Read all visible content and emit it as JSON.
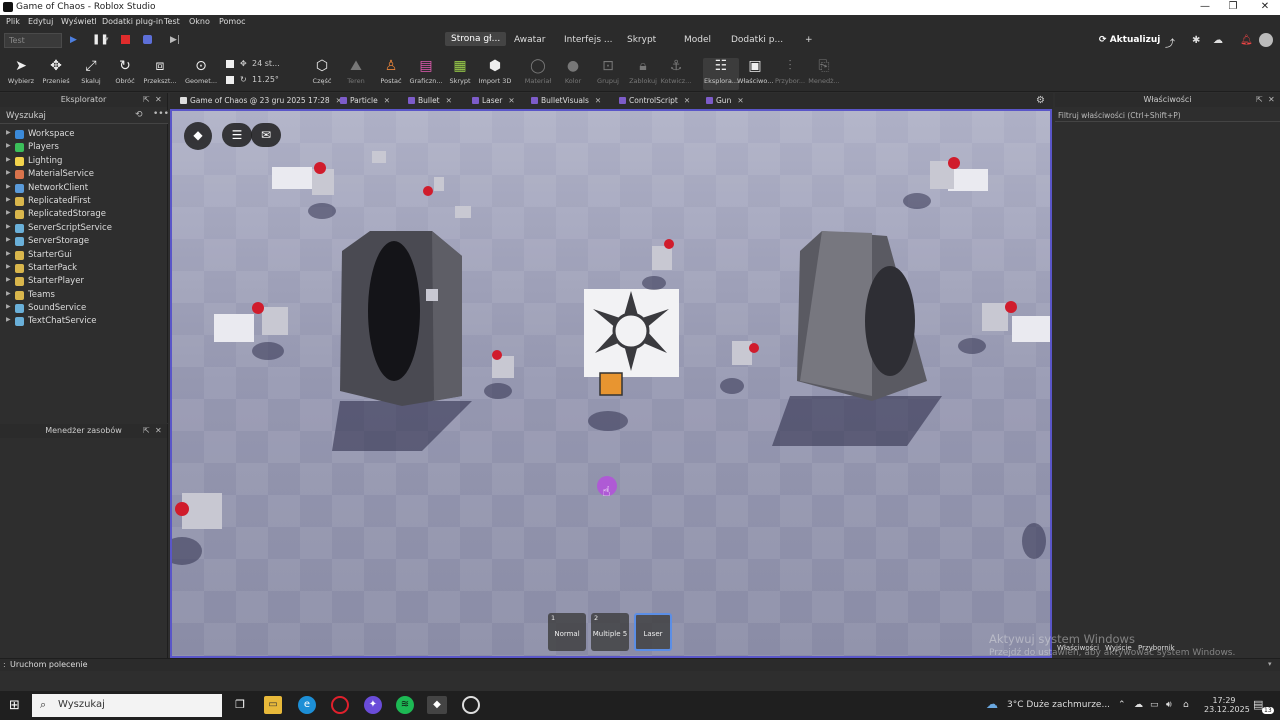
{
  "window": {
    "title": "Game of Chaos - Roblox Studio",
    "minimize": "—",
    "maximize": "❐",
    "close": "✕"
  },
  "menu": [
    "Plik",
    "Edytuj",
    "Wyświetl",
    "Dodatki plug-in",
    "Test",
    "Okno",
    "Pomoc"
  ],
  "ribbon": {
    "test_select": "Test",
    "tabs": [
      "Strona gł...",
      "Awatar",
      "Interfejs ...",
      "Skrypt",
      "Model",
      "Dodatki p..."
    ],
    "active_tab": "Strona gł...",
    "add_tab": "+",
    "update_label": "Aktualizuj"
  },
  "toolbar": {
    "tools": [
      {
        "label": "Wybierz",
        "icon": "cursor-icon"
      },
      {
        "label": "Przenieś",
        "icon": "move-icon"
      },
      {
        "label": "Skaluj",
        "icon": "scale-icon"
      },
      {
        "label": "Obróć",
        "icon": "rotate-icon"
      },
      {
        "label": "Przekszt...",
        "icon": "transform-icon"
      },
      {
        "label": "Geomet...",
        "icon": "geometry-icon"
      },
      {
        "label": "Część",
        "icon": "part-icon"
      },
      {
        "label": "Teren",
        "icon": "terrain-icon"
      },
      {
        "label": "Postać",
        "icon": "character-icon"
      },
      {
        "label": "Graficzn...",
        "icon": "gui-icon"
      },
      {
        "label": "Skrypt",
        "icon": "script-icon"
      },
      {
        "label": "Import 3D",
        "icon": "import-3d-icon"
      },
      {
        "label": "Materiał",
        "icon": "material-icon"
      },
      {
        "label": "Kolor",
        "icon": "color-icon"
      },
      {
        "label": "Grupuj",
        "icon": "group-icon"
      },
      {
        "label": "Zablokuj",
        "icon": "lock-icon"
      },
      {
        "label": "Kotwicz...",
        "icon": "anchor-icon"
      },
      {
        "label": "Eksplora...",
        "icon": "explorer-icon"
      },
      {
        "label": "Właściwo...",
        "icon": "properties-icon"
      },
      {
        "label": "Przybor...",
        "icon": "toolbox-icon"
      },
      {
        "label": "Menedż...",
        "icon": "asset-manager-icon"
      }
    ],
    "move_step": "24 st...",
    "rotate_step": "11.25°"
  },
  "explorer": {
    "title": "Eksplorator",
    "search_placeholder": "Wyszukaj",
    "items": [
      {
        "label": "Workspace",
        "color": "#3b8ad9"
      },
      {
        "label": "Players",
        "color": "#3bbf5a"
      },
      {
        "label": "Lighting",
        "color": "#f2d34c"
      },
      {
        "label": "MaterialService",
        "color": "#d9734c"
      },
      {
        "label": "NetworkClient",
        "color": "#5a9ad9"
      },
      {
        "label": "ReplicatedFirst",
        "color": "#d9b64c"
      },
      {
        "label": "ReplicatedStorage",
        "color": "#d9b64c"
      },
      {
        "label": "ServerScriptService",
        "color": "#6ab0d9"
      },
      {
        "label": "ServerStorage",
        "color": "#6ab0d9"
      },
      {
        "label": "StarterGui",
        "color": "#d9b64c"
      },
      {
        "label": "StarterPack",
        "color": "#d9b64c"
      },
      {
        "label": "StarterPlayer",
        "color": "#d9b64c"
      },
      {
        "label": "Teams",
        "color": "#d9b64c"
      },
      {
        "label": "SoundService",
        "color": "#6ab0d9"
      },
      {
        "label": "TextChatService",
        "color": "#6ab0d9"
      }
    ]
  },
  "asset_manager": {
    "title": "Menedżer zasobów"
  },
  "doc_tabs": [
    {
      "label": "Game of Chaos @ 23 gru 2025 17:28"
    },
    {
      "label": "Particle"
    },
    {
      "label": "Bullet"
    },
    {
      "label": "Laser"
    },
    {
      "label": "BulletVisuals"
    },
    {
      "label": "ControlScript"
    },
    {
      "label": "Gun"
    }
  ],
  "hotbar": [
    {
      "num": "1",
      "label": "Normal"
    },
    {
      "num": "2",
      "label": "Multiple 5"
    },
    {
      "num": "",
      "label": "Laser"
    }
  ],
  "properties": {
    "title": "Właściwości",
    "filter_placeholder": "Filtruj właściwości (Ctrl+Shift+P)"
  },
  "command_bar": {
    "placeholder": "Uruchom polecenie"
  },
  "watermark": {
    "line1": "Aktywuj system Windows",
    "line2": "Przejdź do ustawień, aby aktywować system Windows."
  },
  "bottom_tabs": [
    "Właściwości",
    "Wyjście",
    "Przybornik"
  ],
  "taskbar": {
    "search": "Wyszukaj",
    "weather": "3°C  Duże zachmurze...",
    "time": "17:29",
    "date": "23.12.2025",
    "notif_count": "13"
  }
}
